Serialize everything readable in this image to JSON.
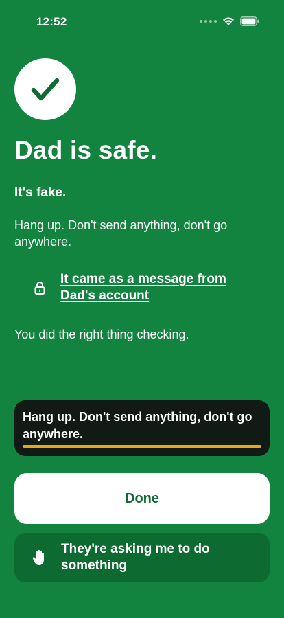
{
  "status_bar": {
    "time": "12:52"
  },
  "result": {
    "headline": "Dad is safe.",
    "subhead": "It's fake.",
    "instruction": "Hang up. Don't send anything, don't go anywhere.",
    "source_link": "It came as a message from Dad's account",
    "reassurance": "You did the right thing checking."
  },
  "caption": {
    "text": "Hang up. Don't send anything, don't go anywhere.",
    "progress_percent": 100
  },
  "actions": {
    "done_label": "Done",
    "asking_label": "They're asking me to do something"
  },
  "colors": {
    "background": "#138440",
    "accent": "#e8a817",
    "caption_bg": "#111a14"
  }
}
